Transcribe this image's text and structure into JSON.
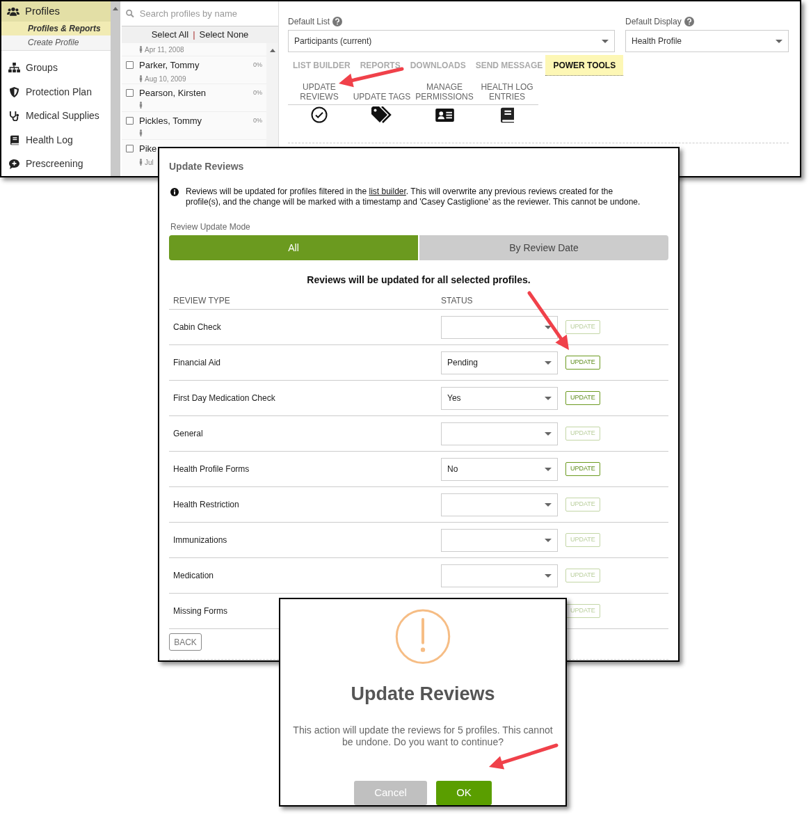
{
  "main_window": {
    "sidebar": {
      "header": "Profiles",
      "subitems": [
        {
          "label": "Profiles & Reports",
          "selected": true
        },
        {
          "label": "Create Profile",
          "selected": false
        }
      ],
      "nav": [
        {
          "label": "Groups"
        },
        {
          "label": "Protection Plan"
        },
        {
          "label": "Medical Supplies"
        },
        {
          "label": "Health Log"
        },
        {
          "label": "Prescreening"
        }
      ]
    },
    "profile_list": {
      "search": {
        "placeholder": "Search profiles by name"
      },
      "select_all": "Select All",
      "separator": "|",
      "select_none": "Select None",
      "rows": [
        {
          "date": "Apr 11, 2008"
        },
        {
          "name": "Parker, Tommy",
          "checked": false,
          "percent": "0%",
          "date": "Aug 10, 2009"
        },
        {
          "name": "Pearson, Kirsten",
          "checked": false,
          "percent": "0%"
        },
        {
          "name": "Pickles, Tommy",
          "checked": false,
          "percent": "0%"
        },
        {
          "name": "Pike",
          "checked": false,
          "date": "Jul"
        }
      ]
    },
    "default_list": {
      "label": "Default List",
      "value": "Participants (current)"
    },
    "default_display": {
      "label": "Default Display",
      "value": "Health Profile"
    },
    "tabs": [
      {
        "label": "LIST BUILDER",
        "selected": false
      },
      {
        "label": "REPORTS",
        "selected": false
      },
      {
        "label": "DOWNLOADS",
        "selected": false
      },
      {
        "label": "SEND MESSAGE",
        "selected": false
      },
      {
        "label": "POWER TOOLS",
        "selected": true
      }
    ],
    "tools": [
      {
        "label": "UPDATE REVIEWS"
      },
      {
        "label": "UPDATE TAGS"
      },
      {
        "label": "MANAGE PERMISSIONS"
      },
      {
        "label": "HEALTH LOG ENTRIES"
      }
    ]
  },
  "update_reviews_panel": {
    "title": "Update Reviews",
    "info": "Reviews will be updated for profiles filtered in the ",
    "info_link": "list builder",
    "info_rest": ". This will overwrite any previous reviews created for the profile(s), and the change will be marked with a timestamp and 'Casey Castiglione' as the reviewer. This cannot be undone.",
    "mode_label": "Review Update Mode",
    "modes": [
      {
        "label": "All",
        "selected": true
      },
      {
        "label": "By Review Date",
        "selected": false
      }
    ],
    "message": "Reviews will be updated for all selected profiles.",
    "columns": [
      "REVIEW TYPE",
      "STATUS"
    ],
    "rows": [
      {
        "type": "Cabin Check",
        "kind": "full",
        "button": "UPDATE",
        "disabled": true
      },
      {
        "type": "Financial Aid",
        "kind": "full",
        "status": "Pending",
        "button": "UPDATE",
        "disabled": false
      },
      {
        "type": "First Day Medication Check",
        "kind": "full",
        "status": "Yes",
        "button": "UPDATE",
        "disabled": false
      },
      {
        "type": "General",
        "kind": "full",
        "button": "UPDATE",
        "disabled": true
      },
      {
        "type": "Health Profile Forms",
        "kind": "full",
        "status": "No",
        "button": "UPDATE",
        "disabled": false
      },
      {
        "type": "Health Restriction",
        "kind": "full",
        "button": "UPDATE",
        "disabled": true
      },
      {
        "type": "Immunizations",
        "kind": "full",
        "button": "UPDATE",
        "disabled": true
      },
      {
        "type": "Medication",
        "kind": "full",
        "button": "UPDATE",
        "disabled": true
      },
      {
        "type": "Missing Forms",
        "kind": "covered",
        "button": "UPDATE",
        "disabled": true
      }
    ],
    "back": "BACK"
  },
  "confirm_dialog": {
    "title": "Update Reviews",
    "message": "This action will update the reviews for 5 profiles. This cannot be undone. Do you want to continue?",
    "buttons": [
      {
        "label": "Cancel",
        "kind": "cancel"
      },
      {
        "label": "OK",
        "kind": "ok"
      }
    ]
  }
}
